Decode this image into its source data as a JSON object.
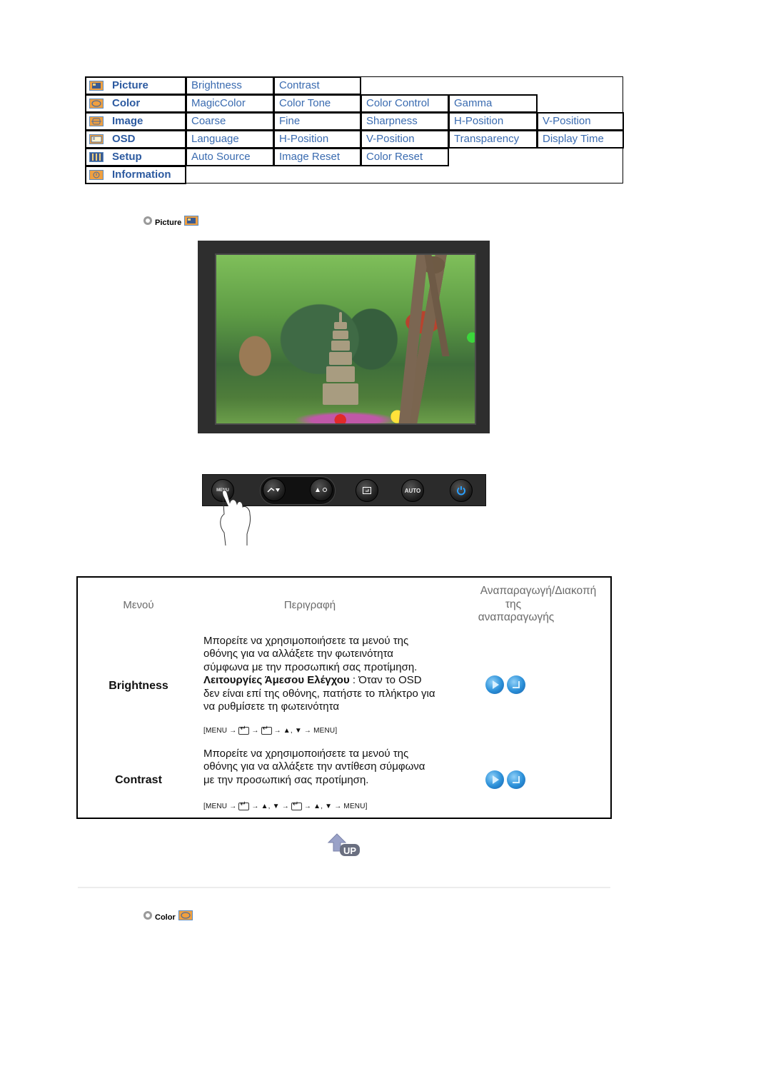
{
  "nav": {
    "rows": [
      {
        "category": "Picture",
        "icon": "picture-icon",
        "items": [
          "Brightness",
          "Contrast"
        ]
      },
      {
        "category": "Color",
        "icon": "color-icon",
        "items": [
          "MagicColor",
          "Color Tone",
          "Color Control",
          "Gamma"
        ]
      },
      {
        "category": "Image",
        "icon": "image-icon",
        "items": [
          "Coarse",
          "Fine",
          "Sharpness",
          "H-Position",
          "V-Position"
        ]
      },
      {
        "category": "OSD",
        "icon": "osd-icon",
        "items": [
          "Language",
          "H-Position",
          "V-Position",
          "Transparency",
          "Display Time"
        ]
      },
      {
        "category": "Setup",
        "icon": "setup-icon",
        "items": [
          "Auto Source",
          "Image Reset",
          "Color Reset"
        ]
      },
      {
        "category": "Information",
        "icon": "information-icon",
        "items": []
      }
    ],
    "colors": {
      "link": "#3a6bb0",
      "category": "#2c5aa0",
      "icon_bg": "#f0a040"
    }
  },
  "section_picture": {
    "title": "Picture"
  },
  "panel": {
    "buttons": [
      "MENU",
      "brightness-down",
      "brightness-up",
      "enter",
      "AUTO",
      "power"
    ],
    "menu_label": "MENU",
    "auto_label": "AUTO"
  },
  "table": {
    "headers": {
      "menu": "Μενού",
      "description": "Περιγραφή",
      "play_stop": "Αναπαραγωγή/Διακοπή της αναπαραγωγής"
    },
    "play_stop_lines": [
      "Αναπαραγωγή/Διακοπή",
      "της",
      "αναπαραγωγής"
    ],
    "rows": [
      {
        "label": "Brightness",
        "description_lines": [
          "Μπορείτε να χρησιμοποιήσετε τα μενού της",
          "οθόνης για να αλλάξετε την φωτεινότητα",
          "σύμφωνα με την προσωπική σας προτίμηση."
        ],
        "direct_label": "Λειτουργίες Άμεσου Ελέγχου",
        "direct_text": " : Όταν το OSD",
        "direct_lines": [
          "δεν είναι επί της οθόνης, πατήστε το πλήκτρο για",
          "να ρυθμίσετε τη φωτεινότητα"
        ],
        "sequence": [
          "[MENU →",
          "enter",
          "→",
          "enter",
          "→ ▲, ▼ → MENU]"
        ]
      },
      {
        "label": "Contrast",
        "description_lines": [
          "Μπορείτε να χρησιμοποιήσετε τα μενού της",
          "οθόνης για να αλλάξετε την αντίθεση σύμφωνα",
          "με την προσωπική σας προτίμηση."
        ],
        "sequence": [
          "[MENU →",
          "enter",
          "→ ▲, ▼ →",
          "enter",
          "→ ▲, ▼ → MENU]"
        ]
      }
    ]
  },
  "up_button": {
    "label": "UP"
  },
  "section_color": {
    "title": "Color"
  }
}
